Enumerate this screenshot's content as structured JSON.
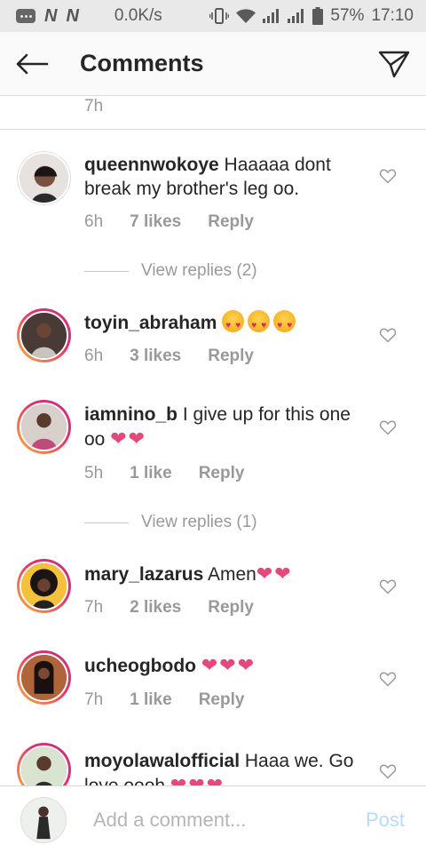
{
  "status_bar": {
    "carrier1": "N",
    "carrier2": "N",
    "speed": "0.0K/s",
    "battery": "57%",
    "time": "17:10"
  },
  "header": {
    "title": "Comments"
  },
  "top_timestamp": "7h",
  "comments": [
    {
      "username": "queennwokoye",
      "text": "Haaaaa dont break my brother's leg oo.",
      "time": "6h",
      "likes": "7 likes",
      "reply": "Reply",
      "view_replies": "View replies (2)"
    },
    {
      "username": "toyin_abraham",
      "text": "",
      "emoji": "smiling-face-with-heart-eyes x3",
      "time": "6h",
      "likes": "3 likes",
      "reply": "Reply"
    },
    {
      "username": "iamnino_b",
      "text": "I give up for this one oo",
      "hearts": "❤❤",
      "time": "5h",
      "likes": "1 like",
      "reply": "Reply",
      "view_replies": "View replies (1)"
    },
    {
      "username": "mary_lazarus",
      "text": "Amen",
      "hearts": "❤❤",
      "time": "7h",
      "likes": "2 likes",
      "reply": "Reply"
    },
    {
      "username": "ucheogbodo",
      "text": "",
      "hearts": "❤❤❤",
      "time": "7h",
      "likes": "1 like",
      "reply": "Reply"
    },
    {
      "username": "moyolawalofficial",
      "text": "Haaa we. Go love oooh",
      "hearts": "❤❤❤"
    }
  ],
  "composer": {
    "placeholder": "Add a comment...",
    "post_label": "Post"
  },
  "colors": {
    "heart_pink": "#e4497a",
    "post_disabled": "#b3dbff",
    "meta_gray": "#999999"
  }
}
